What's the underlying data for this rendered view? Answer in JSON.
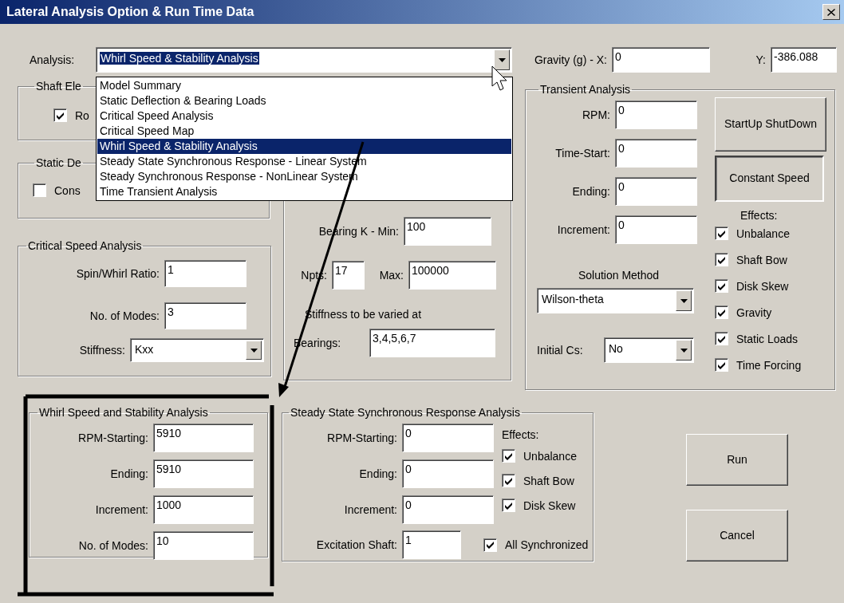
{
  "window": {
    "title": "Lateral Analysis Option & Run Time Data"
  },
  "analysis": {
    "label": "Analysis:",
    "value": "Whirl Speed & Stability Analysis",
    "expanded": true,
    "options": [
      {
        "label": "Model Summary",
        "selected": false
      },
      {
        "label": "Static Deflection & Bearing Loads",
        "selected": false
      },
      {
        "label": "Critical Speed Analysis",
        "selected": false
      },
      {
        "label": "Critical Speed Map",
        "selected": false
      },
      {
        "label": "Whirl Speed & Stability Analysis",
        "selected": true
      },
      {
        "label": "Steady State Synchronous Response - Linear System",
        "selected": false
      },
      {
        "label": "Steady Synchronous Response - NonLinear System",
        "selected": false
      },
      {
        "label": "Time Transient Analysis",
        "selected": false
      }
    ]
  },
  "gravity": {
    "x_label": "Gravity (g) - X:",
    "x_value": "0",
    "y_label": "Y:",
    "y_value": "-386.088"
  },
  "shaft_group": {
    "title": "Shaft Ele",
    "checkbox": {
      "label": "Ro",
      "checked": true
    }
  },
  "static_group": {
    "title": "Static De",
    "checkbox": {
      "label": "Cons",
      "checked": false
    }
  },
  "critical_speed": {
    "title": "Critical Speed Analysis",
    "fields": [
      {
        "label": "Spin/Whirl Ratio:",
        "value": "1"
      },
      {
        "label": "No. of Modes:",
        "value": "3"
      }
    ],
    "stiffness": {
      "label": "Stiffness:",
      "value": "Kxx"
    }
  },
  "bearing_group": {
    "min_label": "Bearing K - Min:",
    "min_value": "100",
    "npts_label": "Npts:",
    "npts_value": "17",
    "max_label": "Max:",
    "max_value": "100000",
    "note": "Stiffness to be varied at",
    "bearings_label": "Bearings:",
    "bearings_value": "3,4,5,6,7"
  },
  "transient": {
    "title": "Transient Analysis",
    "fields": [
      {
        "label": "RPM:",
        "value": "0"
      },
      {
        "label": "Time-Start:",
        "value": "0"
      },
      {
        "label": "Ending:",
        "value": "0"
      },
      {
        "label": "Increment:",
        "value": "0"
      }
    ],
    "modes": [
      {
        "label": "StartUp ShutDown",
        "selected": false
      },
      {
        "label": "Constant Speed",
        "selected": true
      }
    ],
    "effects_label": "Effects:",
    "effects": [
      {
        "label": "Unbalance",
        "checked": true
      },
      {
        "label": "Shaft Bow",
        "checked": true
      },
      {
        "label": "Disk Skew",
        "checked": true
      },
      {
        "label": "Gravity",
        "checked": true
      },
      {
        "label": "Static Loads",
        "checked": true
      },
      {
        "label": "Time Forcing",
        "checked": true
      }
    ],
    "solution_label": "Solution Method",
    "solution_value": "Wilson-theta",
    "initial_label": "Initial Cs:",
    "initial_value": "No"
  },
  "whirl": {
    "title": "Whirl Speed and Stability Analysis",
    "fields": [
      {
        "label": "RPM-Starting:",
        "value": "5910"
      },
      {
        "label": "Ending:",
        "value": "5910"
      },
      {
        "label": "Increment:",
        "value": "1000"
      },
      {
        "label": "No. of Modes:",
        "value": "10"
      }
    ]
  },
  "steady": {
    "title": "Steady State Synchronous Response Analysis",
    "fields": [
      {
        "label": "RPM-Starting:",
        "value": "0"
      },
      {
        "label": "Ending:",
        "value": "0"
      },
      {
        "label": "Increment:",
        "value": "0"
      }
    ],
    "effects_label": "Effects:",
    "effects": [
      {
        "label": "Unbalance",
        "checked": true
      },
      {
        "label": "Shaft Bow",
        "checked": true
      },
      {
        "label": "Disk Skew",
        "checked": true
      }
    ],
    "excitation": {
      "label": "Excitation Shaft:",
      "value": "1"
    },
    "all_synchronized": {
      "label": "All Synchronized",
      "checked": true
    }
  },
  "buttons": [
    {
      "label": "Run"
    },
    {
      "label": "Cancel"
    }
  ]
}
